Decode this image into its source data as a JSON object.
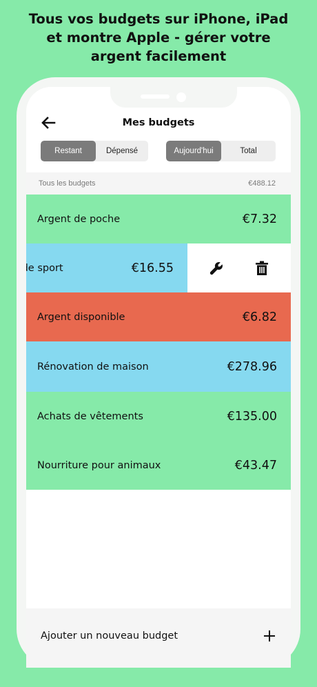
{
  "headline": {
    "line1": "Tous vos budgets sur iPhone, iPad",
    "line2": "et montre Apple - gérer votre",
    "line3": "argent facilement"
  },
  "header": {
    "title": "Mes budgets",
    "back_icon": "back-arrow-icon"
  },
  "toggles": {
    "mode": {
      "options": [
        "Restant",
        "Dépensé"
      ],
      "selected": "Restant"
    },
    "period": {
      "options": [
        "Aujourd'hui",
        "Total"
      ],
      "selected": "Aujourd'hui"
    }
  },
  "summary": {
    "label": "Tous les budgets",
    "total": "€488.12"
  },
  "budgets": [
    {
      "name": "Argent de poche",
      "amount": "€7.32",
      "color": "#86eaa9"
    },
    {
      "name": "Salle de sport",
      "visible_name": "lle de sport",
      "amount": "€16.55",
      "color": "#86d9f0",
      "swiped": true
    },
    {
      "name": "Argent disponible",
      "amount": "€6.82",
      "color": "#e8694f"
    },
    {
      "name": "Rénovation de maison",
      "amount": "€278.96",
      "color": "#86d9f0"
    },
    {
      "name": "Achats de vêtements",
      "amount": "€135.00",
      "color": "#86eaa9"
    },
    {
      "name": "Nourriture pour animaux",
      "amount": "€43.47",
      "color": "#86eaa9"
    }
  ],
  "swipe_actions": {
    "edit_icon": "wrench-icon",
    "delete_icon": "trash-icon"
  },
  "footer": {
    "add_label": "Ajouter un nouveau budget",
    "add_icon": "plus-icon"
  },
  "colors": {
    "background": "#86eaa9",
    "green": "#86eaa9",
    "blue": "#86d9f0",
    "red": "#e8694f"
  }
}
